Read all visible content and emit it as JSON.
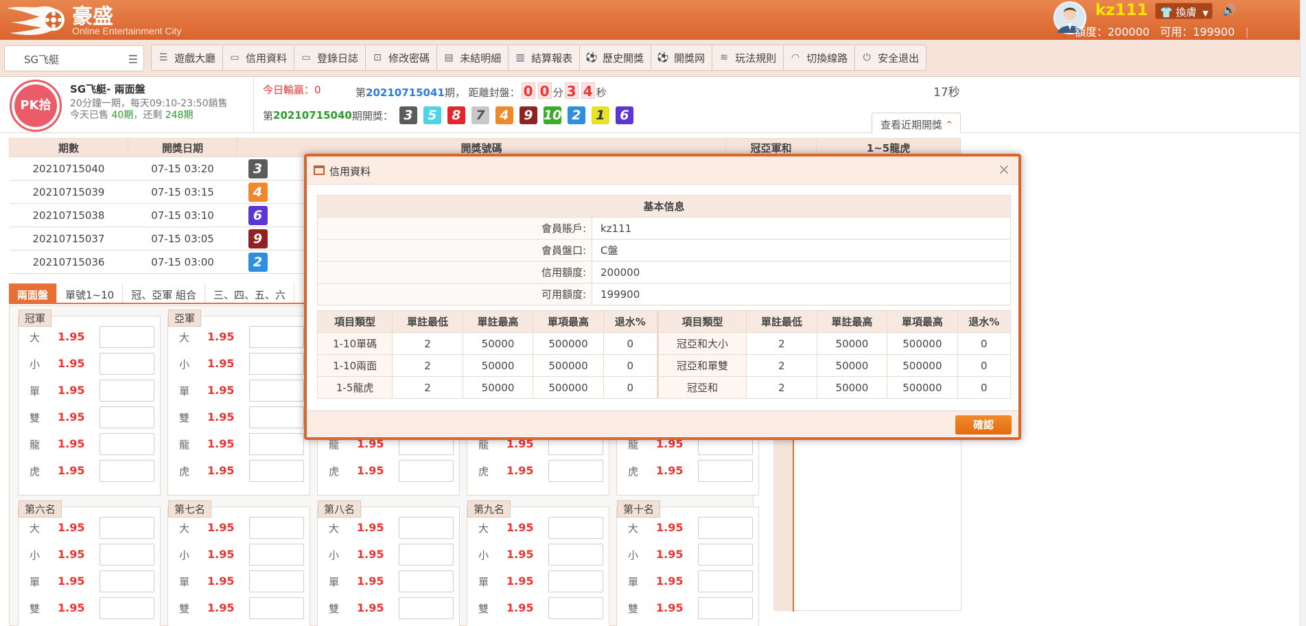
{
  "header": {
    "brand": "豪盛",
    "brand_sub": "Online Entertainment City",
    "username": "kz111",
    "skin_label": "換膚",
    "credit_label": "額度：200000",
    "available_label": "可用：199900",
    "separator": "|"
  },
  "nav": {
    "game_select": "SG飞艇",
    "items": [
      {
        "label": "遊戲大廳",
        "icon": "list-icon"
      },
      {
        "label": "信用資料",
        "icon": "id-card-icon"
      },
      {
        "label": "登錄日誌",
        "icon": "monitor-icon"
      },
      {
        "label": "修改密碼",
        "icon": "lock-icon"
      },
      {
        "label": "未結明細",
        "icon": "document-icon"
      },
      {
        "label": "結算報表",
        "icon": "bar-chart-icon"
      },
      {
        "label": "歷史開獎",
        "icon": "ball-icon"
      },
      {
        "label": "開獎网",
        "icon": "ball-icon"
      },
      {
        "label": "玩法規則",
        "icon": "layers-icon"
      },
      {
        "label": "切換線路",
        "icon": "wifi-icon"
      },
      {
        "label": "安全退出",
        "icon": "power-icon"
      }
    ]
  },
  "info": {
    "logo_text": "PK拾",
    "game_name": "SG飞艇- 兩面盤",
    "schedule": "20分鐘一期，每天09:10-23:50銷售",
    "sold_prefix": "今天已售 ",
    "sold_count": "40期",
    "remain_prefix": "，还剩 ",
    "remain_count": "248期",
    "today_win": "今日輸贏：0",
    "period_prefix": "第",
    "current_period": "20210715041",
    "period_suffix": "期，  距離封盤：",
    "countdown": [
      "0",
      "0",
      "3",
      "4"
    ],
    "minute_unit": "分",
    "second_unit": "秒",
    "timer": "17秒",
    "last_prefix": "第",
    "last_period": "20210715040",
    "last_suffix": "期開獎：",
    "last_balls": [
      3,
      5,
      8,
      7,
      4,
      9,
      10,
      2,
      1,
      6
    ],
    "recent_btn": "查看近期開獎"
  },
  "ball_colors": {
    "1": "#e8e12a",
    "2": "#2e8fe0",
    "3": "#5b5b5b",
    "4": "#f0882e",
    "5": "#4cd3e6",
    "6": "#5b35d6",
    "7": "#c8c8c8",
    "8": "#e2262b",
    "9": "#8f2323",
    "10": "#3aab2a"
  },
  "results": {
    "headers": [
      "期數",
      "開獎日期",
      "開獎號碼",
      "冠亞軍和",
      "1~5龍虎"
    ],
    "rows": [
      {
        "period": "20210715040",
        "date": "07-15 03:20",
        "first": 3
      },
      {
        "period": "20210715039",
        "date": "07-15 03:15",
        "first": 4
      },
      {
        "period": "20210715038",
        "date": "07-15 03:10",
        "first": 6
      },
      {
        "period": "20210715037",
        "date": "07-15 03:05",
        "first": 9
      },
      {
        "period": "20210715036",
        "date": "07-15 03:00",
        "first": 2
      }
    ]
  },
  "tabs": [
    "兩面盤",
    "單號1~10",
    "冠、亞軍 組合",
    "三、四、五、六"
  ],
  "bet_groups": [
    {
      "title": "冠軍",
      "rows": [
        [
          "大",
          "1.95"
        ],
        [
          "小",
          "1.95"
        ],
        [
          "單",
          "1.95"
        ],
        [
          "雙",
          "1.95"
        ],
        [
          "龍",
          "1.95"
        ],
        [
          "虎",
          "1.95"
        ]
      ]
    },
    {
      "title": "亞軍",
      "rows": [
        [
          "大",
          "1.95"
        ],
        [
          "小",
          "1.95"
        ],
        [
          "單",
          "1.95"
        ],
        [
          "雙",
          "1.95"
        ],
        [
          "龍",
          "1.95"
        ],
        [
          "虎",
          "1.95"
        ]
      ]
    },
    {
      "title": "",
      "rows": [
        [
          "龍",
          "1.95"
        ],
        [
          "虎",
          "1.95"
        ]
      ]
    },
    {
      "title": "",
      "rows": [
        [
          "龍",
          "1.95"
        ],
        [
          "虎",
          "1.95"
        ]
      ]
    },
    {
      "title": "",
      "rows": [
        [
          "龍",
          "1.95"
        ],
        [
          "虎",
          "1.95"
        ]
      ]
    },
    {
      "title": "第六名",
      "rows": [
        [
          "大",
          "1.95"
        ],
        [
          "小",
          "1.95"
        ],
        [
          "單",
          "1.95"
        ],
        [
          "雙",
          "1.95"
        ]
      ]
    },
    {
      "title": "第七名",
      "rows": [
        [
          "大",
          "1.95"
        ],
        [
          "小",
          "1.95"
        ],
        [
          "單",
          "1.95"
        ],
        [
          "雙",
          "1.95"
        ]
      ]
    },
    {
      "title": "第八名",
      "rows": [
        [
          "大",
          "1.95"
        ],
        [
          "小",
          "1.95"
        ],
        [
          "單",
          "1.95"
        ],
        [
          "雙",
          "1.95"
        ]
      ]
    },
    {
      "title": "第九名",
      "rows": [
        [
          "大",
          "1.95"
        ],
        [
          "小",
          "1.95"
        ],
        [
          "單",
          "1.95"
        ],
        [
          "雙",
          "1.95"
        ]
      ]
    },
    {
      "title": "第十名",
      "rows": [
        [
          "大",
          "1.95"
        ],
        [
          "小",
          "1.95"
        ],
        [
          "單",
          "1.95"
        ],
        [
          "雙",
          "1.95"
        ]
      ]
    }
  ],
  "modal": {
    "title": "信用資料",
    "basic_title": "基本信息",
    "basic_rows": [
      {
        "k": "會員賬戶:",
        "v": "kz111"
      },
      {
        "k": "會員盤口:",
        "v": "C盤"
      },
      {
        "k": "信用額度:",
        "v": "200000"
      },
      {
        "k": "可用額度:",
        "v": "199900"
      }
    ],
    "limit_headers": [
      "項目類型",
      "單註最低",
      "單註最高",
      "單項最高",
      "退水%"
    ],
    "limit_rows": [
      [
        [
          "1-10單碼",
          "2",
          "50000",
          "500000",
          "0"
        ],
        [
          "冠亞和大小",
          "2",
          "50000",
          "500000",
          "0"
        ]
      ],
      [
        [
          "1-10兩面",
          "2",
          "50000",
          "500000",
          "0"
        ],
        [
          "冠亞和單雙",
          "2",
          "50000",
          "500000",
          "0"
        ]
      ],
      [
        [
          "1-5龍虎",
          "2",
          "50000",
          "500000",
          "0"
        ],
        [
          "冠亞和",
          "2",
          "50000",
          "500000",
          "0"
        ]
      ]
    ],
    "ok_label": "確認"
  }
}
